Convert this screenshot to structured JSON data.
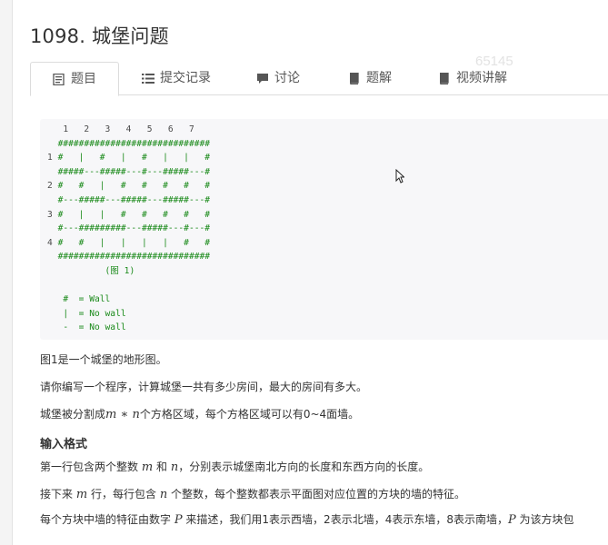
{
  "problem": {
    "title": "1098. 城堡问题",
    "watermark": "65145"
  },
  "tabs": [
    {
      "label": "题目",
      "icon": "document-icon",
      "active": true
    },
    {
      "label": "提交记录",
      "icon": "list-icon",
      "active": false
    },
    {
      "label": "讨论",
      "icon": "comment-icon",
      "active": false
    },
    {
      "label": "题解",
      "icon": "book-icon",
      "active": false
    },
    {
      "label": "视频讲解",
      "icon": "book-icon",
      "active": false
    }
  ],
  "code": {
    "header": "   1   2   3   4   5   6   7",
    "lines": [
      {
        "num": " ",
        "text": "#############################"
      },
      {
        "num": "1",
        "text": "#   |   #   |   #   |   |   #"
      },
      {
        "num": " ",
        "text": "#####---#####---#---#####---#"
      },
      {
        "num": "2",
        "text": "#   #   |   #   #   #   #   #"
      },
      {
        "num": " ",
        "text": "#---#####---#####---#####---#"
      },
      {
        "num": "3",
        "text": "#   |   |   #   #   #   #   #"
      },
      {
        "num": " ",
        "text": "#---#########---#####---#---#"
      },
      {
        "num": "4",
        "text": "#   #   |   |   |   |   #   #"
      },
      {
        "num": " ",
        "text": "#############################"
      }
    ],
    "caption": "           (图 1)",
    "legend": [
      "   #  = Wall",
      "   |  = No wall",
      "   -  = No wall"
    ]
  },
  "content": {
    "p1": "图1是一个城堡的地形图。",
    "p2": "请你编写一个程序，计算城堡一共有多少房间，最大的房间有多大。",
    "p3_a": "城堡被分割成",
    "p3_math": "m ∗ n",
    "p3_b": "个方格区域，每个方格区域可以有0~4面墙。",
    "input_heading": "输入格式",
    "p4_a": "第一行包含两个整数",
    "p4_m": "m",
    "p4_b": "和",
    "p4_n": "n",
    "p4_c": "，分别表示城堡南北方向的长度和东西方向的长度。",
    "p5_a": "接下来",
    "p5_m": "m",
    "p5_b": "行，每行包含",
    "p5_n": "n",
    "p5_c": "个整数，每个整数都表示平面图对应位置的方块的墙的特征。",
    "p6_a": "每个方块中墙的特征由数字",
    "p6_P": "P",
    "p6_b": "来描述，我们用1表示西墙，2表示北墙，4表示东墙，8表示南墙，",
    "p6_P2": "P",
    "p6_c": "为该方块包"
  }
}
